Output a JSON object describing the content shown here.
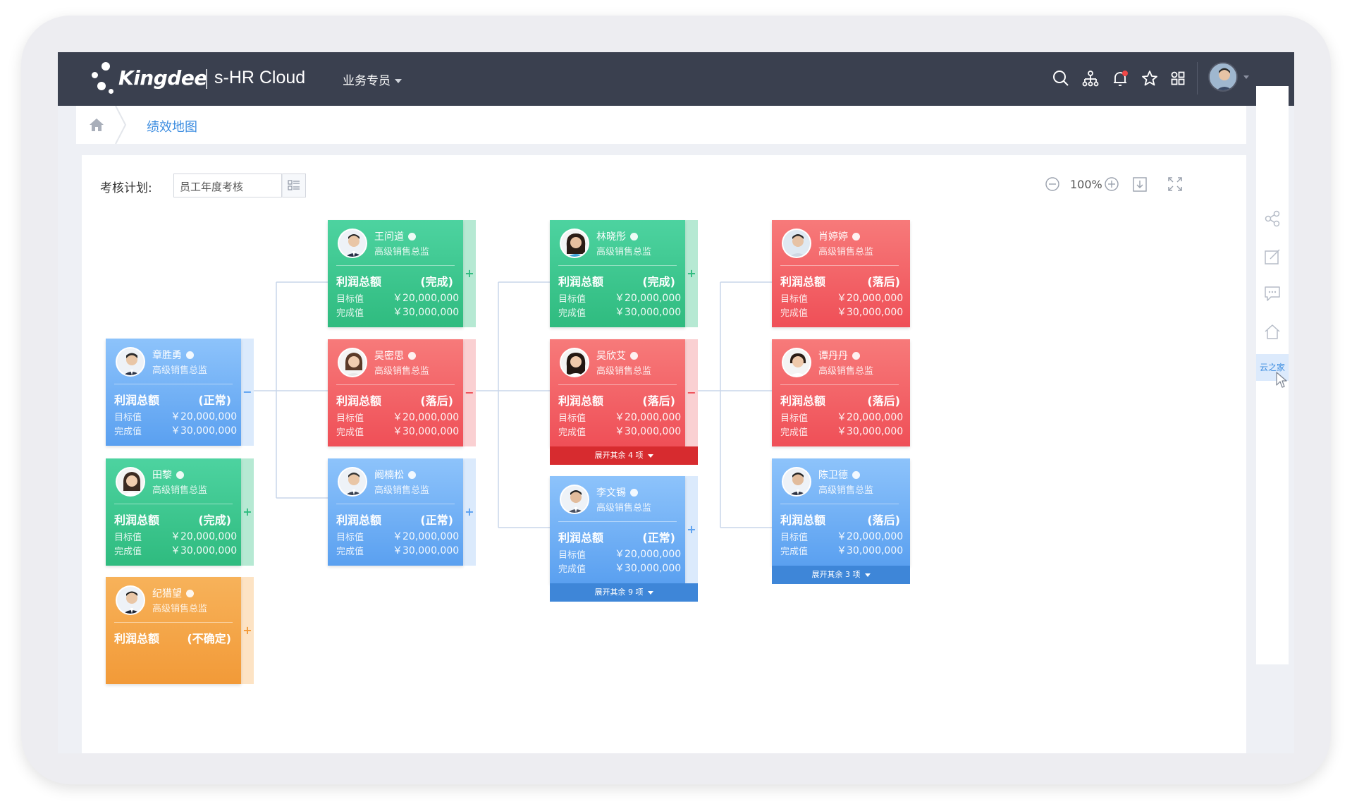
{
  "topbar": {
    "brand": "Kingdee",
    "product": "s-HR Cloud",
    "role": "业务专员",
    "icons": [
      "search-icon",
      "org-chart-icon",
      "bell-icon",
      "star-icon",
      "apps-grid-icon"
    ]
  },
  "breadcrumb": {
    "current": "绩效地图"
  },
  "toolbar": {
    "plan_label": "考核计划:",
    "plan_value": "员工年度考核",
    "zoom": "100%"
  },
  "sidebar": {
    "active_label": "云之家"
  },
  "labels": {
    "metric": "利润总额",
    "target": "目标值",
    "done": "完成值"
  },
  "cards": [
    {
      "name": "章胜勇",
      "title": "高级销售总监",
      "status": "(正常)",
      "target": "￥20,000,000",
      "actual": "￥30,000,000",
      "color": "blue",
      "toggle": "−"
    },
    {
      "name": "田黎",
      "title": "高级销售总监",
      "status": "(完成)",
      "target": "￥20,000,000",
      "actual": "￥30,000,000",
      "color": "green",
      "toggle": "+"
    },
    {
      "name": "纪猎望",
      "title": "高级销售总监",
      "status": "(不确定)",
      "target": "",
      "actual": "",
      "color": "orange",
      "toggle": "+"
    },
    {
      "name": "王问道",
      "title": "高级销售总监",
      "status": "(完成)",
      "target": "￥20,000,000",
      "actual": "￥30,000,000",
      "color": "green",
      "toggle": "+"
    },
    {
      "name": "吴密思",
      "title": "高级销售总监",
      "status": "(落后)",
      "target": "￥20,000,000",
      "actual": "￥30,000,000",
      "color": "red",
      "toggle": "−"
    },
    {
      "name": "阚楠松",
      "title": "高级销售总监",
      "status": "(正常)",
      "target": "￥20,000,000",
      "actual": "￥30,000,000",
      "color": "blue",
      "toggle": "+"
    },
    {
      "name": "林晓彤",
      "title": "高级销售总监",
      "status": "(完成)",
      "target": "￥20,000,000",
      "actual": "￥30,000,000",
      "color": "green",
      "toggle": "+"
    },
    {
      "name": "吴欣艾",
      "title": "高级销售总监",
      "status": "(落后)",
      "target": "￥20,000,000",
      "actual": "￥30,000,000",
      "color": "red",
      "toggle": "−",
      "expand": "展开其余 4 项"
    },
    {
      "name": "李文锡",
      "title": "高级销售总监",
      "status": "(正常)",
      "target": "￥20,000,000",
      "actual": "￥30,000,000",
      "color": "blue",
      "toggle": "+",
      "expand": "展开其余 9 项"
    },
    {
      "name": "肖婷婷",
      "title": "高级销售总监",
      "status": "(落后)",
      "target": "￥20,000,000",
      "actual": "￥30,000,000",
      "color": "red",
      "toggle": ""
    },
    {
      "name": "谭丹丹",
      "title": "高级销售总监",
      "status": "(落后)",
      "target": "￥20,000,000",
      "actual": "￥30,000,000",
      "color": "red",
      "toggle": ""
    },
    {
      "name": "陈卫德",
      "title": "高级销售总监",
      "status": "(落后)",
      "target": "￥20,000,000",
      "actual": "￥30,000,000",
      "color": "blue",
      "toggle": "",
      "expand": "展开其余 3 项"
    }
  ],
  "colors": {
    "topbar": "#3a404f",
    "green": "#2fbb7f",
    "red": "#ef4f57",
    "blue": "#5aa0f0",
    "orange": "#f29a38",
    "link": "#3d8de0"
  }
}
